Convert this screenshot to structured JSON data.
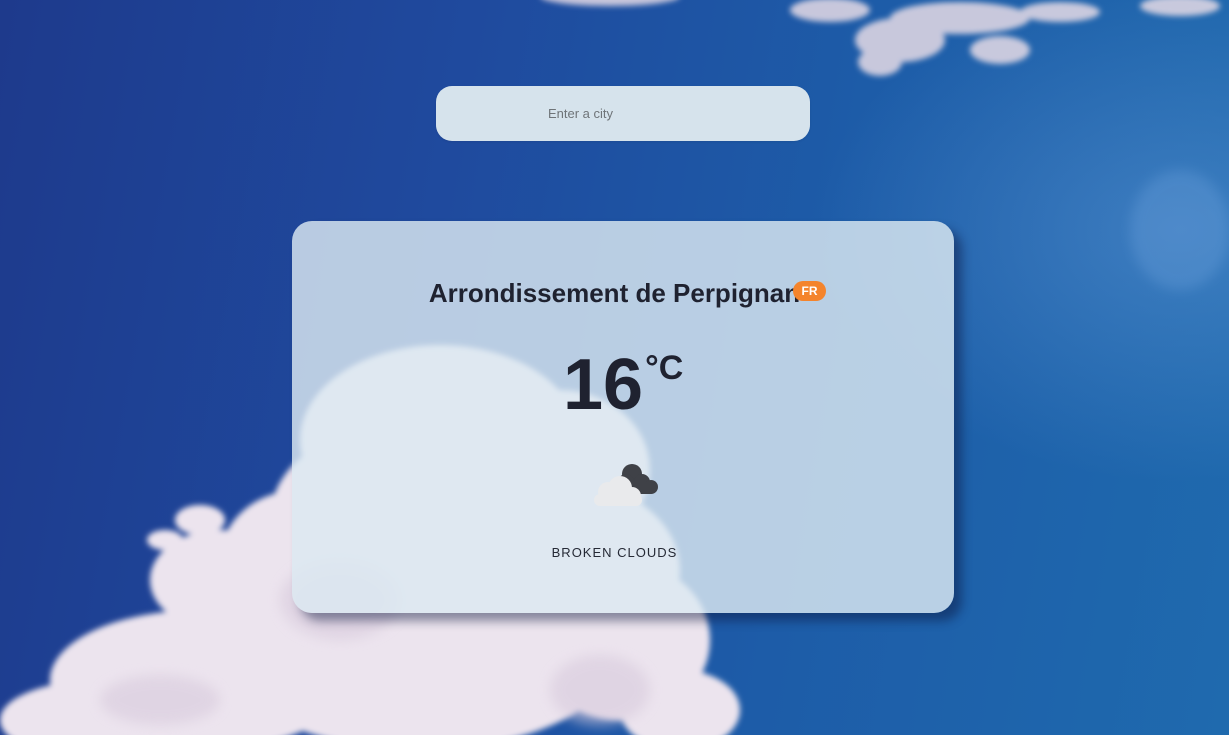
{
  "search": {
    "placeholder": "Enter a city",
    "value": ""
  },
  "weather": {
    "city": "Arrondissement de Perpignan",
    "country": "FR",
    "temperature": "16",
    "unit": "°C",
    "icon": "broken-clouds-icon",
    "description": "BROKEN CLOUDS"
  },
  "colors": {
    "sky_blue": "#1f4a9e",
    "card_background": "#dce9f2",
    "country_badge": "#f4842c",
    "text_dark": "#1f2230"
  }
}
